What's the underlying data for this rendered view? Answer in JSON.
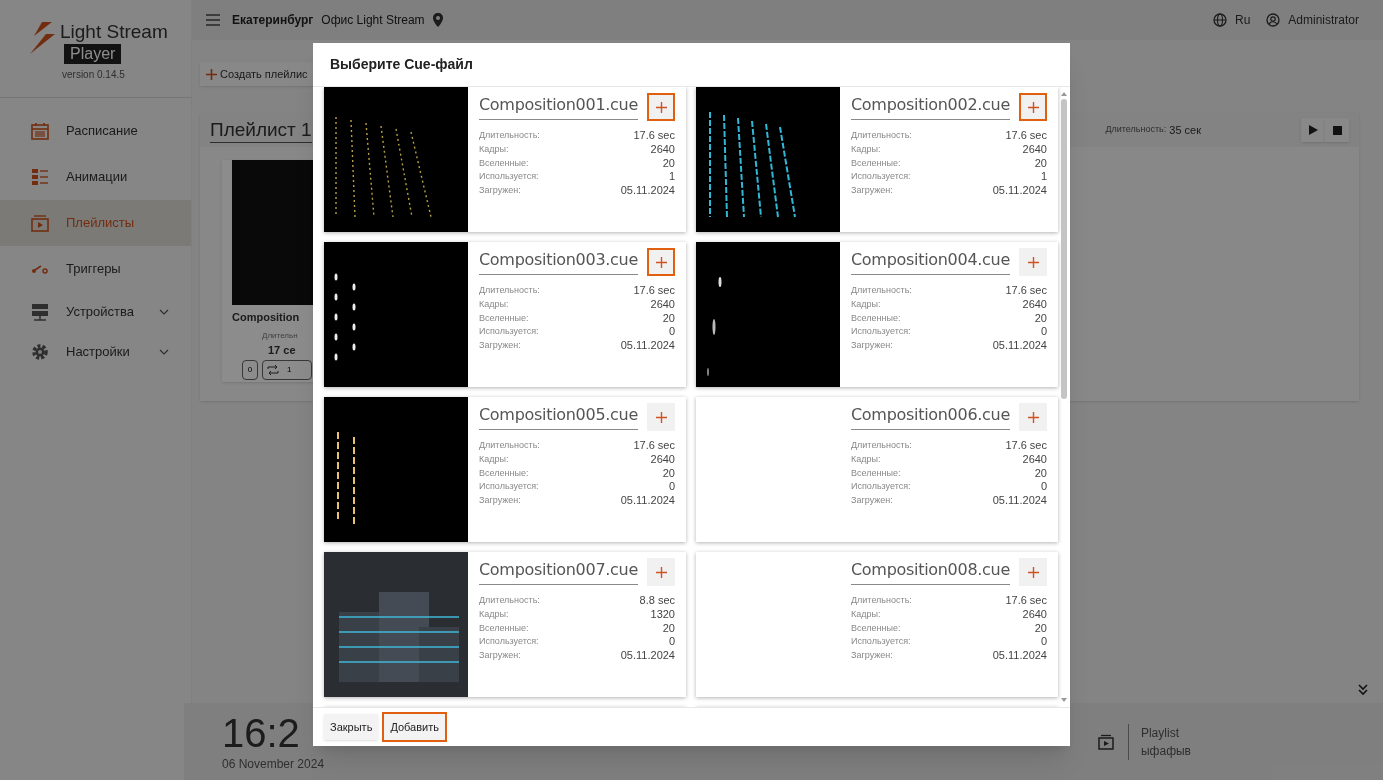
{
  "sidebar": {
    "logo": {
      "name": "Light Stream",
      "product": "Player",
      "version": "version 0.14.5"
    },
    "items": [
      {
        "label": "Расписание",
        "selected": false,
        "expandable": false
      },
      {
        "label": "Анимации",
        "selected": false,
        "expandable": false
      },
      {
        "label": "Плейлисты",
        "selected": true,
        "expandable": false
      },
      {
        "label": "Триггеры",
        "selected": false,
        "expandable": false
      },
      {
        "label": "Устройства",
        "selected": false,
        "expandable": true
      },
      {
        "label": "Настройки",
        "selected": false,
        "expandable": true
      }
    ]
  },
  "header": {
    "city": "Екатеринбург",
    "office": "Офис Light Stream",
    "language": "Ru",
    "user": "Administrator"
  },
  "toolbar": {
    "create_button": "Создать плейлис"
  },
  "playlist": {
    "title": "Плейлист 1",
    "duration_label": "Длительность:",
    "duration": "35 сек",
    "item": {
      "name": "Composition",
      "duration_label": "Длительн",
      "duration": "17 се",
      "count_1": "0",
      "count_2": "1"
    }
  },
  "now_playing": {
    "time": "16:2",
    "date": "06 November 2024",
    "label": "Playlist",
    "playlist": "ыфафыв"
  },
  "dialog": {
    "title": "Выберите Cue-файл",
    "files": [
      {
        "name": "Composition001.cue",
        "kind": "gold",
        "selected": true,
        "stats": [
          {
            "label": "Длительность:",
            "value": "17.6 sec"
          },
          {
            "label": "Кадры:",
            "value": "2640"
          },
          {
            "label": "Вселенные:",
            "value": "20"
          },
          {
            "label": "Используется:",
            "value": "1"
          },
          {
            "label": "Загружен:",
            "value": "05.11.2024"
          }
        ]
      },
      {
        "name": "Composition002.cue",
        "kind": "cyan",
        "selected": true,
        "stats": [
          {
            "label": "Длительность:",
            "value": "17.6 sec"
          },
          {
            "label": "Кадры:",
            "value": "2640"
          },
          {
            "label": "Вселенные:",
            "value": "20"
          },
          {
            "label": "Используется:",
            "value": "1"
          },
          {
            "label": "Загружен:",
            "value": "05.11.2024"
          }
        ]
      },
      {
        "name": "Composition003.cue",
        "kind": "dots",
        "selected": true,
        "stats": [
          {
            "label": "Длительность:",
            "value": "17.6 sec"
          },
          {
            "label": "Кадры:",
            "value": "2640"
          },
          {
            "label": "Вселенные:",
            "value": "20"
          },
          {
            "label": "Используется:",
            "value": "0"
          },
          {
            "label": "Загружен:",
            "value": "05.11.2024"
          }
        ]
      },
      {
        "name": "Composition004.cue",
        "kind": "spark",
        "selected": false,
        "stats": [
          {
            "label": "Длительность:",
            "value": "17.6 sec"
          },
          {
            "label": "Кадры:",
            "value": "2640"
          },
          {
            "label": "Вселенные:",
            "value": "20"
          },
          {
            "label": "Используется:",
            "value": "0"
          },
          {
            "label": "Загружен:",
            "value": "05.11.2024"
          }
        ]
      },
      {
        "name": "Composition005.cue",
        "kind": "warm",
        "selected": false,
        "stats": [
          {
            "label": "Длительность:",
            "value": "17.6 sec"
          },
          {
            "label": "Кадры:",
            "value": "2640"
          },
          {
            "label": "Вселенные:",
            "value": "20"
          },
          {
            "label": "Используется:",
            "value": "0"
          },
          {
            "label": "Загружен:",
            "value": "05.11.2024"
          }
        ]
      },
      {
        "name": "Composition006.cue",
        "kind": "blank",
        "selected": false,
        "stats": [
          {
            "label": "Длительность:",
            "value": "17.6 sec"
          },
          {
            "label": "Кадры:",
            "value": "2640"
          },
          {
            "label": "Вселенные:",
            "value": "20"
          },
          {
            "label": "Используется:",
            "value": "0"
          },
          {
            "label": "Загружен:",
            "value": "05.11.2024"
          }
        ]
      },
      {
        "name": "Composition007.cue",
        "kind": "city",
        "selected": false,
        "stats": [
          {
            "label": "Длительность:",
            "value": "8.8 sec"
          },
          {
            "label": "Кадры:",
            "value": "1320"
          },
          {
            "label": "Вселенные:",
            "value": "20"
          },
          {
            "label": "Используется:",
            "value": "0"
          },
          {
            "label": "Загружен:",
            "value": "05.11.2024"
          }
        ]
      },
      {
        "name": "Composition008.cue",
        "kind": "blank",
        "selected": false,
        "stats": [
          {
            "label": "Длительность:",
            "value": "17.6 sec"
          },
          {
            "label": "Кадры:",
            "value": "2640"
          },
          {
            "label": "Вселенные:",
            "value": "20"
          },
          {
            "label": "Используется:",
            "value": "0"
          },
          {
            "label": "Загружен:",
            "value": "05.11.2024"
          }
        ]
      }
    ],
    "buttons": [
      {
        "label": "Закрыть",
        "highlighted": false
      },
      {
        "label": "Добавить",
        "highlighted": true
      }
    ]
  }
}
